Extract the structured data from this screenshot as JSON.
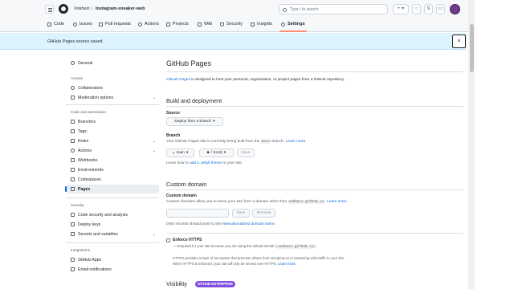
{
  "header": {
    "owner": "Xokhezi",
    "separator": "/",
    "repo": "Instagram-sneaker-web",
    "search_placeholder": "Type / to search",
    "plus_label": "+ ▾"
  },
  "repo_nav": {
    "tabs": [
      {
        "label": "Code"
      },
      {
        "label": "Issues"
      },
      {
        "label": "Pull requests"
      },
      {
        "label": "Actions"
      },
      {
        "label": "Projects"
      },
      {
        "label": "Wiki"
      },
      {
        "label": "Security"
      },
      {
        "label": "Insights"
      },
      {
        "label": "Settings"
      }
    ]
  },
  "flash": {
    "message": "GitHub Pages source saved.",
    "close": "×"
  },
  "sidebar": {
    "general": "General",
    "access_heading": "Access",
    "collaborators": "Collaborators",
    "moderation": "Moderation options",
    "code_heading": "Code and automation",
    "branches": "Branches",
    "tags": "Tags",
    "rules": "Rules",
    "actions": "Actions",
    "webhooks": "Webhooks",
    "environments": "Environments",
    "codespaces": "Codespaces",
    "pages": "Pages",
    "security_heading": "Security",
    "code_security": "Code security and analysis",
    "deploy_keys": "Deploy keys",
    "secrets": "Secrets and variables",
    "integrations_heading": "Integrations",
    "github_apps": "GitHub Apps",
    "email_notifications": "Email notifications"
  },
  "main": {
    "title": "GitHub Pages",
    "intro_link": "GitHub Pages",
    "intro_rest": " is designed to host your personal, organization, or project pages from a GitHub repository.",
    "build_heading": "Build and deployment",
    "source_label": "Source",
    "source_value": "Deploy from a branch",
    "branch_label": "Branch",
    "branch_desc_a": "Your GitHub Pages site is currently being built from the ",
    "branch_desc_code": "main",
    "branch_desc_b": " branch. ",
    "branch_learn": "Learn more",
    "branch_desc_end": ".",
    "branch_button": "main",
    "folder_button": "/ (root)",
    "save_button": "Save",
    "jekyll_a": "Learn how to ",
    "jekyll_link": "add a Jekyll theme",
    "jekyll_b": " to your site.",
    "custom_heading": "Custom domain",
    "custom_label": "Custom domain",
    "custom_desc_a": "Custom domains allow you to serve your site from a domain other than ",
    "custom_desc_code": "xokhezi.github.io",
    "custom_desc_b": ". ",
    "custom_learn": "Learn more",
    "custom_desc_end": ".",
    "domain_save": "Save",
    "domain_remove": "Remove",
    "dns_a": "DNS records should point to the ",
    "dns_link": "internationalized domain name",
    "dns_b": ".",
    "https_label": "Enforce HTTPS",
    "https_req_a": "— Required for your site because you are using the default domain (",
    "https_req_code": "xokhezi.github.io",
    "https_req_b": ")",
    "https_desc1": "HTTPS provides a layer of encryption that prevents others from snooping on or tampering with traffic to your site.",
    "https_desc2_a": "When HTTPS is enforced, your site will only be served over HTTPS. ",
    "https_learn": "Learn more",
    "https_desc2_end": ".",
    "visibility_heading": "Visibility",
    "visibility_badge": "GITHUB ENTERPRISE"
  }
}
